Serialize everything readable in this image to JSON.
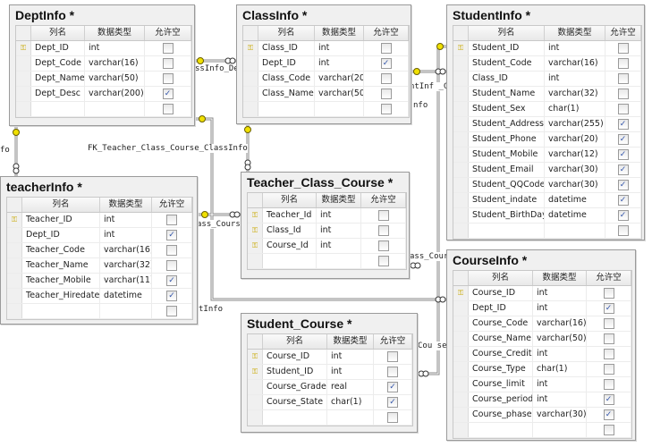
{
  "headers": {
    "name": "列名",
    "type": "数据类型",
    "nullable": "允许空"
  },
  "tables": {
    "DeptInfo": {
      "title": "DeptInfo *",
      "rows": [
        {
          "name": "Dept_ID",
          "type": "int",
          "nullable": false,
          "key": true
        },
        {
          "name": "Dept_Code",
          "type": "varchar(16)",
          "nullable": false
        },
        {
          "name": "Dept_Name",
          "type": "varchar(50)",
          "nullable": false
        },
        {
          "name": "Dept_Desc",
          "type": "varchar(200)",
          "nullable": true
        },
        {
          "name": "",
          "type": "",
          "nullable": false
        }
      ]
    },
    "ClassInfo": {
      "title": "ClassInfo *",
      "rows": [
        {
          "name": "Class_ID",
          "type": "int",
          "nullable": false,
          "key": true
        },
        {
          "name": "Dept_ID",
          "type": "int",
          "nullable": true
        },
        {
          "name": "Class_Code",
          "type": "varchar(20)",
          "nullable": false
        },
        {
          "name": "Class_Name",
          "type": "varchar(50)",
          "nullable": false
        },
        {
          "name": "",
          "type": "",
          "nullable": false
        }
      ]
    },
    "StudentInfo": {
      "title": "StudentInfo *",
      "rows": [
        {
          "name": "Student_ID",
          "type": "int",
          "nullable": false,
          "key": true
        },
        {
          "name": "Student_Code",
          "type": "varchar(16)",
          "nullable": false
        },
        {
          "name": "Class_ID",
          "type": "int",
          "nullable": false
        },
        {
          "name": "Student_Name",
          "type": "varchar(32)",
          "nullable": false
        },
        {
          "name": "Student_Sex",
          "type": "char(1)",
          "nullable": false
        },
        {
          "name": "Student_Address",
          "type": "varchar(255)",
          "nullable": true
        },
        {
          "name": "Student_Phone",
          "type": "varchar(20)",
          "nullable": true
        },
        {
          "name": "Student_Mobile",
          "type": "varchar(12)",
          "nullable": true
        },
        {
          "name": "Student_Email",
          "type": "varchar(30)",
          "nullable": true
        },
        {
          "name": "Student_QQCode",
          "type": "varchar(30)",
          "nullable": true
        },
        {
          "name": "Student_indate",
          "type": "datetime",
          "nullable": true
        },
        {
          "name": "Student_BirthDay",
          "type": "datetime",
          "nullable": true
        },
        {
          "name": "",
          "type": "",
          "nullable": false
        }
      ]
    },
    "teacherInfo": {
      "title": "teacherInfo *",
      "rows": [
        {
          "name": "Teacher_ID",
          "type": "int",
          "nullable": false,
          "key": true
        },
        {
          "name": "Dept_ID",
          "type": "int",
          "nullable": true
        },
        {
          "name": "Teacher_Code",
          "type": "varchar(16)",
          "nullable": false
        },
        {
          "name": "Teacher_Name",
          "type": "varchar(32)",
          "nullable": false
        },
        {
          "name": "Teacher_Mobile",
          "type": "varchar(11)",
          "nullable": true
        },
        {
          "name": "Teacher_Hiredate",
          "type": "datetime",
          "nullable": true
        },
        {
          "name": "",
          "type": "",
          "nullable": false
        }
      ]
    },
    "Teacher_Class_Course": {
      "title": "Teacher_Class_Course *",
      "rows": [
        {
          "name": "Teacher_Id",
          "type": "int",
          "nullable": false,
          "key": true
        },
        {
          "name": "Class_Id",
          "type": "int",
          "nullable": false,
          "key": true
        },
        {
          "name": "Course_Id",
          "type": "int",
          "nullable": false,
          "key": true
        },
        {
          "name": "",
          "type": "",
          "nullable": false
        }
      ]
    },
    "CourseInfo": {
      "title": "CourseInfo *",
      "rows": [
        {
          "name": "Course_ID",
          "type": "int",
          "nullable": false,
          "key": true
        },
        {
          "name": "Dept_ID",
          "type": "int",
          "nullable": true
        },
        {
          "name": "Course_Code",
          "type": "varchar(16)",
          "nullable": false
        },
        {
          "name": "Course_Name",
          "type": "varchar(50)",
          "nullable": false
        },
        {
          "name": "Course_Credit",
          "type": "int",
          "nullable": false
        },
        {
          "name": "Course_Type",
          "type": "char(1)",
          "nullable": false
        },
        {
          "name": "Course_limit",
          "type": "int",
          "nullable": false
        },
        {
          "name": "Course_period",
          "type": "int",
          "nullable": true
        },
        {
          "name": "Course_phase",
          "type": "varchar(30)",
          "nullable": true
        },
        {
          "name": "",
          "type": "",
          "nullable": false
        }
      ]
    },
    "Student_Course": {
      "title": "Student_Course *",
      "rows": [
        {
          "name": "Course_ID",
          "type": "int",
          "nullable": false,
          "key": true
        },
        {
          "name": "Student_ID",
          "type": "int",
          "nullable": false,
          "key": true
        },
        {
          "name": "Course_Grade",
          "type": "real",
          "nullable": true
        },
        {
          "name": "Course_State",
          "type": "char(1)",
          "nullable": true
        },
        {
          "name": "",
          "type": "",
          "nullable": false
        }
      ]
    }
  },
  "relationship_labels": {
    "dept_class": "ssInfo_De",
    "tcc_classinfo": "FK_Teacher_Class_Course_ClassInfo",
    "student_class": "ntInf _C",
    "student_class2": "nfo",
    "dept_teacher": "fo",
    "tcc_teacher": "ass_Cours",
    "course_dept": "tInfo",
    "tcc_course": "ass_Cour",
    "sc_course": "Cou se_"
  },
  "colors": {
    "key": "#c8a800",
    "line": "#8a8a8a",
    "frame": "#f0f0f0"
  }
}
